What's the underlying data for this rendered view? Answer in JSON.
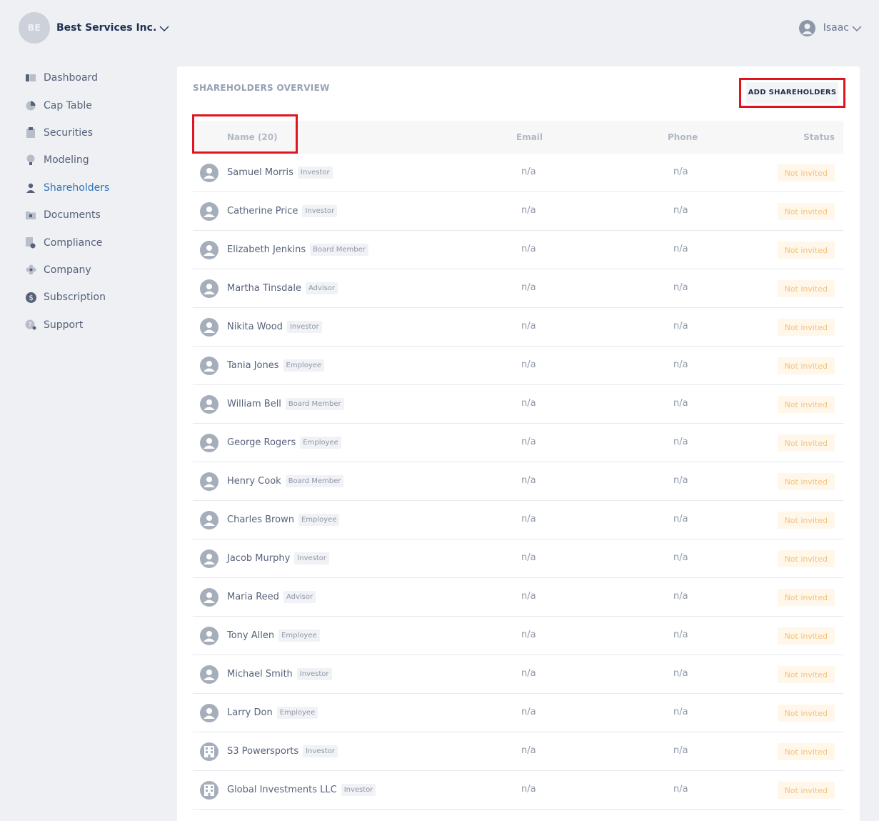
{
  "header": {
    "org_initials": "BE",
    "org_name": "Best Services Inc.",
    "user_name": "Isaac"
  },
  "sidebar": {
    "items": [
      {
        "label": "Dashboard",
        "icon": "dashboard-icon"
      },
      {
        "label": "Cap Table",
        "icon": "pie-chart-icon"
      },
      {
        "label": "Securities",
        "icon": "clipboard-icon"
      },
      {
        "label": "Modeling",
        "icon": "lightbulb-icon"
      },
      {
        "label": "Shareholders",
        "icon": "person-icon",
        "active": true
      },
      {
        "label": "Documents",
        "icon": "folder-icon"
      },
      {
        "label": "Compliance",
        "icon": "document-check-icon"
      },
      {
        "label": "Company",
        "icon": "flower-icon"
      },
      {
        "label": "Subscription",
        "icon": "dollar-icon"
      },
      {
        "label": "Support",
        "icon": "help-icon"
      }
    ]
  },
  "main": {
    "title": "SHAREHOLDERS OVERVIEW",
    "add_button": "ADD SHAREHOLDERS",
    "columns": {
      "name": "Name (20)",
      "email": "Email",
      "phone": "Phone",
      "status": "Status"
    },
    "rows": [
      {
        "name": "Samuel Morris",
        "role": "Investor",
        "email": "n/a",
        "phone": "n/a",
        "status": "Not invited",
        "type": "person"
      },
      {
        "name": "Catherine Price",
        "role": "Investor",
        "email": "n/a",
        "phone": "n/a",
        "status": "Not invited",
        "type": "person"
      },
      {
        "name": "Elizabeth Jenkins",
        "role": "Board Member",
        "email": "n/a",
        "phone": "n/a",
        "status": "Not invited",
        "type": "person"
      },
      {
        "name": "Martha Tinsdale",
        "role": "Advisor",
        "email": "n/a",
        "phone": "n/a",
        "status": "Not invited",
        "type": "person"
      },
      {
        "name": "Nikita Wood",
        "role": "Investor",
        "email": "n/a",
        "phone": "n/a",
        "status": "Not invited",
        "type": "person"
      },
      {
        "name": "Tania Jones",
        "role": "Employee",
        "email": "n/a",
        "phone": "n/a",
        "status": "Not invited",
        "type": "person"
      },
      {
        "name": "William Bell",
        "role": "Board Member",
        "email": "n/a",
        "phone": "n/a",
        "status": "Not invited",
        "type": "person"
      },
      {
        "name": "George Rogers",
        "role": "Employee",
        "email": "n/a",
        "phone": "n/a",
        "status": "Not invited",
        "type": "person"
      },
      {
        "name": "Henry Cook",
        "role": "Board Member",
        "email": "n/a",
        "phone": "n/a",
        "status": "Not invited",
        "type": "person"
      },
      {
        "name": "Charles Brown",
        "role": "Employee",
        "email": "n/a",
        "phone": "n/a",
        "status": "Not invited",
        "type": "person"
      },
      {
        "name": "Jacob Murphy",
        "role": "Investor",
        "email": "n/a",
        "phone": "n/a",
        "status": "Not invited",
        "type": "person"
      },
      {
        "name": "Maria Reed",
        "role": "Advisor",
        "email": "n/a",
        "phone": "n/a",
        "status": "Not invited",
        "type": "person"
      },
      {
        "name": "Tony Allen",
        "role": "Employee",
        "email": "n/a",
        "phone": "n/a",
        "status": "Not invited",
        "type": "person"
      },
      {
        "name": "Michael Smith",
        "role": "Investor",
        "email": "n/a",
        "phone": "n/a",
        "status": "Not invited",
        "type": "person"
      },
      {
        "name": "Larry Don",
        "role": "Employee",
        "email": "n/a",
        "phone": "n/a",
        "status": "Not invited",
        "type": "person"
      },
      {
        "name": "S3 Powersports",
        "role": "Investor",
        "email": "n/a",
        "phone": "n/a",
        "status": "Not invited",
        "type": "company"
      },
      {
        "name": "Global Investments LLC",
        "role": "Investor",
        "email": "n/a",
        "phone": "n/a",
        "status": "Not invited",
        "type": "company"
      }
    ]
  },
  "colors": {
    "active_nav": "#2b74b8",
    "highlight": "#e0141f",
    "status_bg": "#fff7ea",
    "status_text": "#f4c27c"
  }
}
